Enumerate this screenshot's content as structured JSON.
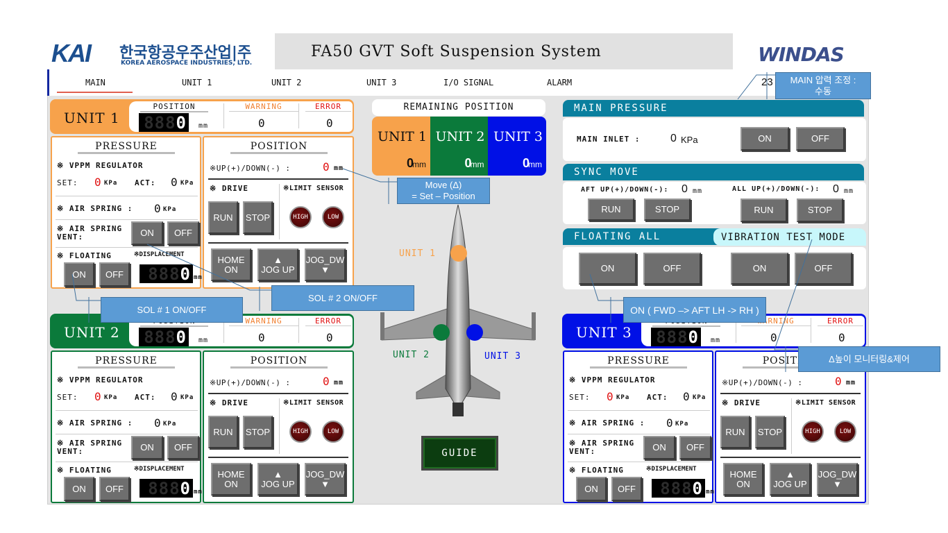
{
  "header": {
    "logo_mark": "KAI",
    "logo_korean": "한국항공우주산업|주",
    "logo_english": "KOREA AEROSPACE INDUSTRIES, LTD.",
    "title": "FA50 GVT Soft Suspension System",
    "brand": "WINDAS"
  },
  "nav": {
    "tabs": [
      "MAIN",
      "UNIT 1",
      "UNIT 2",
      "UNIT 3",
      "I/O SIGNAL",
      "ALARM"
    ],
    "active": "MAIN",
    "counter": "23"
  },
  "labels": {
    "position": "POSITION",
    "warning": "WARNING",
    "error": "ERROR",
    "mm": "mm",
    "pressure": "PRESSURE",
    "vppm": "※ VPPM REGULATOR",
    "set": "SET:",
    "act": "ACT:",
    "kpa": "KPa",
    "air_spring": "※ AIR SPRING :",
    "air_spring_vent": "※ AIR SPRING\nVENT:",
    "floating": "※ FLOATING",
    "displacement": "※DISPLACEMENT",
    "updown": "※UP(+)/DOWN(-) :",
    "drive": "※ DRIVE",
    "limit_sensor": "※LIMIT SENSOR",
    "on": "ON",
    "off": "OFF",
    "run": "RUN",
    "stop": "STOP",
    "high": "HIGH",
    "low": "LOW",
    "home_on": "HOME\nON",
    "jog_up": "▲\nJOG UP",
    "jog_dw": "JOG_DW\n▼"
  },
  "units": [
    {
      "label": "UNIT 1",
      "color": "#f7a24b",
      "text_color": "#111111",
      "position": "0",
      "warning": "0",
      "error": "0",
      "set": "0",
      "act": "0",
      "air_spring": "0",
      "displacement": "0",
      "updown": "0",
      "remaining": "0"
    },
    {
      "label": "UNIT 2",
      "color": "#0b7a3b",
      "text_color": "#ffffff",
      "position": "0",
      "warning": "0",
      "error": "0",
      "set": "0",
      "act": "0",
      "air_spring": "0",
      "displacement": "0",
      "updown": "0",
      "remaining": "0"
    },
    {
      "label": "UNIT 3",
      "color": "#0010e6",
      "text_color": "#ffffff",
      "position": "0",
      "warning": "0",
      "error": "0",
      "set": "0",
      "act": "0",
      "air_spring": "0",
      "displacement": "0",
      "updown": "0",
      "remaining": "0"
    }
  ],
  "remaining": {
    "title": "REMAINING POSITION",
    "unit": "mm"
  },
  "aircraft": {
    "unit1": "UNIT 1",
    "unit2": "UNIT 2",
    "unit3": "UNIT 3"
  },
  "guide": "GUIDE",
  "main_pressure": {
    "title": "MAIN PRESSURE",
    "inlet_label": "MAIN INLET  :",
    "inlet_value": "0",
    "inlet_unit": "KPa",
    "on": "ON",
    "off": "OFF"
  },
  "sync_move": {
    "title": "SYNC MOVE",
    "aft_label": "AFT UP(+)/DOWN(-):",
    "aft_value": "0",
    "all_label": "ALL UP(+)/DOWN(-):",
    "all_value": "0",
    "unit": "mm",
    "run": "RUN",
    "stop": "STOP"
  },
  "floating_all": {
    "title": "FLOATING ALL",
    "on": "ON",
    "off": "OFF"
  },
  "vibration": {
    "title": "VIBRATION TEST MODE",
    "on": "ON",
    "off": "OFF"
  },
  "callouts": {
    "main_pressure": "MAIN 압력 조정 :\n수동",
    "move": "Move (Δ)\n= Set – Position",
    "sol1": "SOL # 1 ON/OFF",
    "sol2": "SOL # 2 ON/OFF",
    "floating_on": "ON ( FWD –> AFT LH -> RH )",
    "delta": "Δ높이 모니터링&제어"
  }
}
